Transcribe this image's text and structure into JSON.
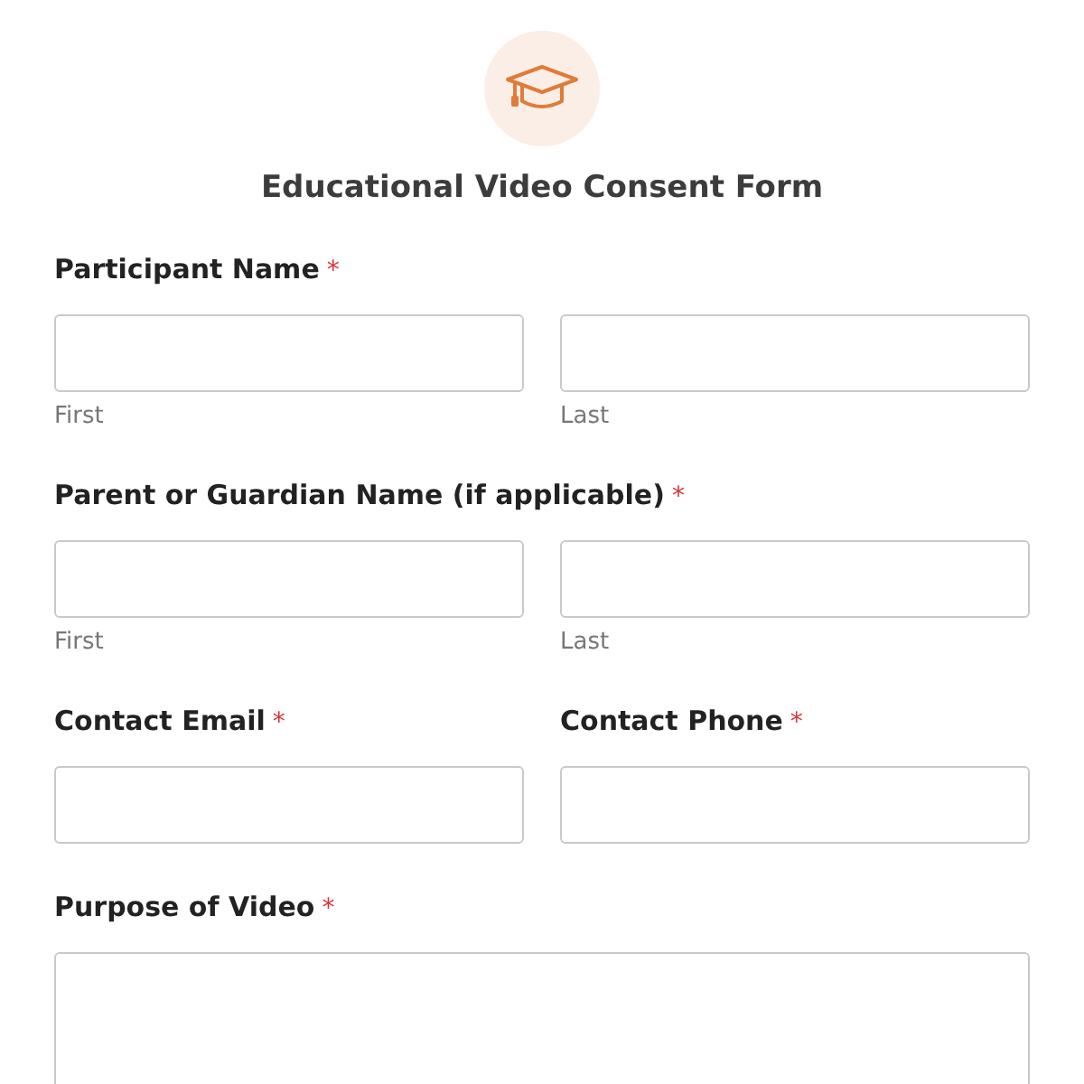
{
  "form": {
    "title": "Educational Video Consent Form"
  },
  "sections": [
    {
      "kind": "name",
      "label": "Participant Name",
      "required_mark": "*",
      "parts": [
        {
          "sublabel": "First"
        },
        {
          "sublabel": "Last"
        }
      ]
    },
    {
      "kind": "name",
      "label": "Parent or Guardian Name (if applicable)",
      "required_mark": "*",
      "parts": [
        {
          "sublabel": "First"
        },
        {
          "sublabel": "Last"
        }
      ]
    },
    {
      "kind": "pair",
      "fields": [
        {
          "label": "Contact Email",
          "required_mark": "*"
        },
        {
          "label": "Contact Phone",
          "required_mark": "*"
        }
      ]
    },
    {
      "kind": "textarea",
      "label": "Purpose of Video",
      "required_mark": "*"
    }
  ]
}
